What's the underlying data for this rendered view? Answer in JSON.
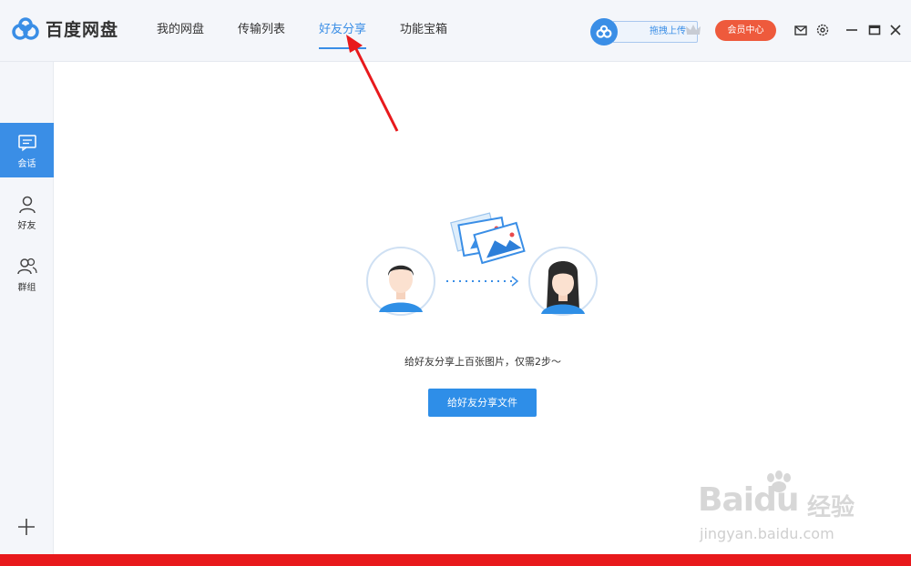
{
  "app": {
    "title": "百度网盘"
  },
  "nav": {
    "tabs": [
      {
        "label": "我的网盘"
      },
      {
        "label": "传输列表"
      },
      {
        "label": "好友分享"
      },
      {
        "label": "功能宝箱"
      }
    ],
    "active_tab": "好友分享"
  },
  "toolbar": {
    "upload_label": "拖拽上传",
    "vip_label": "会员中心"
  },
  "sidebar": {
    "items": [
      {
        "label": "会话",
        "icon": "chat-icon"
      },
      {
        "label": "好友",
        "icon": "user-icon"
      },
      {
        "label": "群组",
        "icon": "group-icon"
      }
    ],
    "add_icon": "plus-icon"
  },
  "main": {
    "empty_text": "给好友分享上百张图片，仅需2步～",
    "share_button_label": "给好友分享文件"
  },
  "watermark": {
    "brand": "Baidu",
    "brand_cn": "经验",
    "url": "jingyan.baidu.com"
  },
  "colors": {
    "accent": "#3a8ee6",
    "vip": "#ee5a3c",
    "annotation": "#e8191c"
  }
}
